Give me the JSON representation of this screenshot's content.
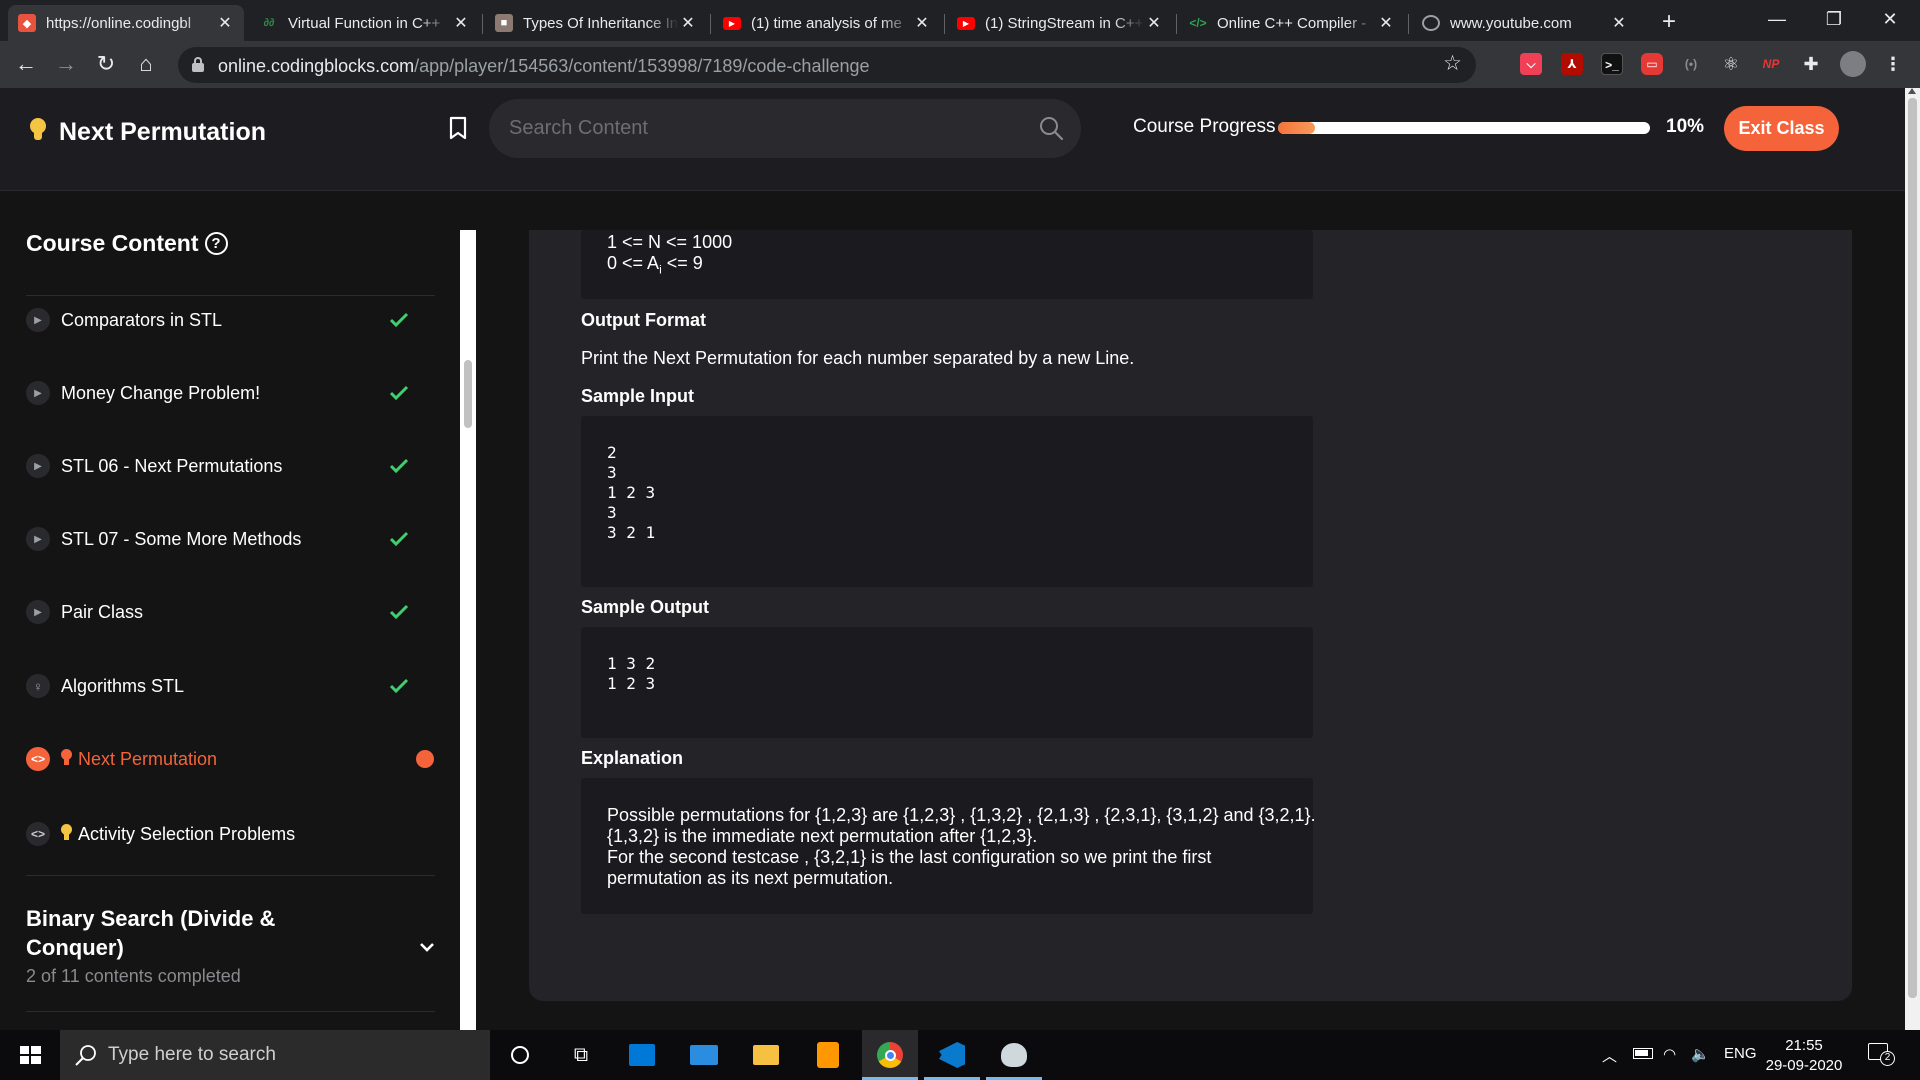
{
  "browser": {
    "tabs": [
      {
        "title": "https://online.codingbl",
        "favicon": "codingblocks-icon",
        "active": true
      },
      {
        "title": "Virtual Function in C++",
        "favicon": "gfg-icon",
        "active": false
      },
      {
        "title": "Types Of Inheritance In",
        "favicon": "cube-icon",
        "active": false
      },
      {
        "title": "(1) time analysis of me",
        "favicon": "youtube-icon",
        "active": false
      },
      {
        "title": "(1) StringStream in C++",
        "favicon": "youtube-icon",
        "active": false
      },
      {
        "title": "Online C++ Compiler -",
        "favicon": "code-icon",
        "active": false
      },
      {
        "title": "www.youtube.com",
        "favicon": "globe-icon",
        "active": false
      }
    ],
    "url_host": "online.codingblocks.com",
    "url_path": "/app/player/154563/content/153998/7189/code-challenge",
    "extension_labels": {
      "np": "NP"
    }
  },
  "header": {
    "title": "Next Permutation",
    "search_placeholder": "Search Content",
    "progress_label": "Course Progress",
    "progress_value": 10,
    "progress_text": "10%",
    "exit_label": "Exit Class"
  },
  "sidebar": {
    "heading": "Course Content",
    "help_glyph": "?",
    "lessons": [
      {
        "label": "Comparators in STL",
        "icon": "play-icon",
        "status": "done"
      },
      {
        "label": "Money Change Problem!",
        "icon": "play-icon",
        "status": "done"
      },
      {
        "label": "STL 06 - Next Permutations",
        "icon": "play-icon",
        "status": "done"
      },
      {
        "label": "STL 07 - Some More Methods",
        "icon": "play-icon",
        "status": "done"
      },
      {
        "label": "Pair Class",
        "icon": "play-icon",
        "status": "done"
      },
      {
        "label": "Algorithms STL",
        "icon": "quiz-icon",
        "status": "done"
      },
      {
        "label": "Next Permutation",
        "icon": "code-icon",
        "status": "current"
      },
      {
        "label": "Activity Selection Problems",
        "icon": "code-icon",
        "status": "pending"
      }
    ],
    "section": {
      "title_line1": "Binary Search (Divide &",
      "title_line2": "Conquer)",
      "subtitle": "2 of 11 contents completed"
    }
  },
  "problem": {
    "constraints": [
      "1 <= N <= 1000",
      "0 <= A",
      "i",
      " <= 9"
    ],
    "output_format_label": "Output Format",
    "output_format_text": "Print the Next Permutation for each number separated by a new Line.",
    "sample_input_label": "Sample Input",
    "sample_input_lines": [
      "2",
      "3",
      "1 2 3",
      "3",
      "3 2 1"
    ],
    "sample_output_label": "Sample Output",
    "sample_output_lines": [
      "1 3 2",
      "1 2 3"
    ],
    "explanation_label": "Explanation",
    "explanation_lines": [
      "Possible permutations for {1,2,3} are {1,2,3} , {1,3,2} , {2,1,3} , {2,3,1}, {3,1,2} and {3,2,1}.",
      "{1,3,2} is the immediate next permutation after {1,2,3}.",
      "For the second testcase , {3,2,1} is the last configuration so we print the first",
      "permutation as its next permutation."
    ]
  },
  "taskbar": {
    "search_placeholder": "Type here to search",
    "language": "ENG",
    "time": "21:55",
    "date": "29-09-2020",
    "notification_count": "2"
  },
  "colors": {
    "accent": "#f4633a",
    "check": "#3ecf6e",
    "panel": "#232328",
    "codebox": "#1b1b1f"
  }
}
